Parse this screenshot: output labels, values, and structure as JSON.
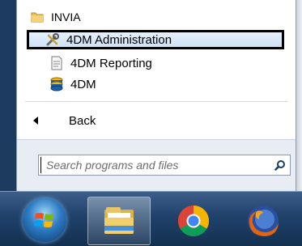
{
  "start_menu": {
    "items": [
      {
        "label": "INVIA",
        "icon": "folder-icon"
      },
      {
        "label": "4DM Administration",
        "icon": "tools-icon",
        "highlighted": true
      },
      {
        "label": "4DM Reporting",
        "icon": "document-icon"
      },
      {
        "label": "4DM",
        "icon": "database-icon"
      }
    ],
    "back_label": "Back",
    "search": {
      "placeholder": "Search programs and files",
      "value": ""
    }
  },
  "taskbar": {
    "items": [
      {
        "name": "start-button",
        "icon": "windows-logo-icon"
      },
      {
        "name": "file-explorer",
        "icon": "folder-library-icon",
        "active": true
      },
      {
        "name": "chrome",
        "icon": "chrome-icon"
      },
      {
        "name": "firefox",
        "icon": "firefox-icon"
      }
    ]
  },
  "colors": {
    "highlight_bg": "#cfe1f5",
    "highlight_border": "#000000",
    "taskbar": "#21436d"
  }
}
